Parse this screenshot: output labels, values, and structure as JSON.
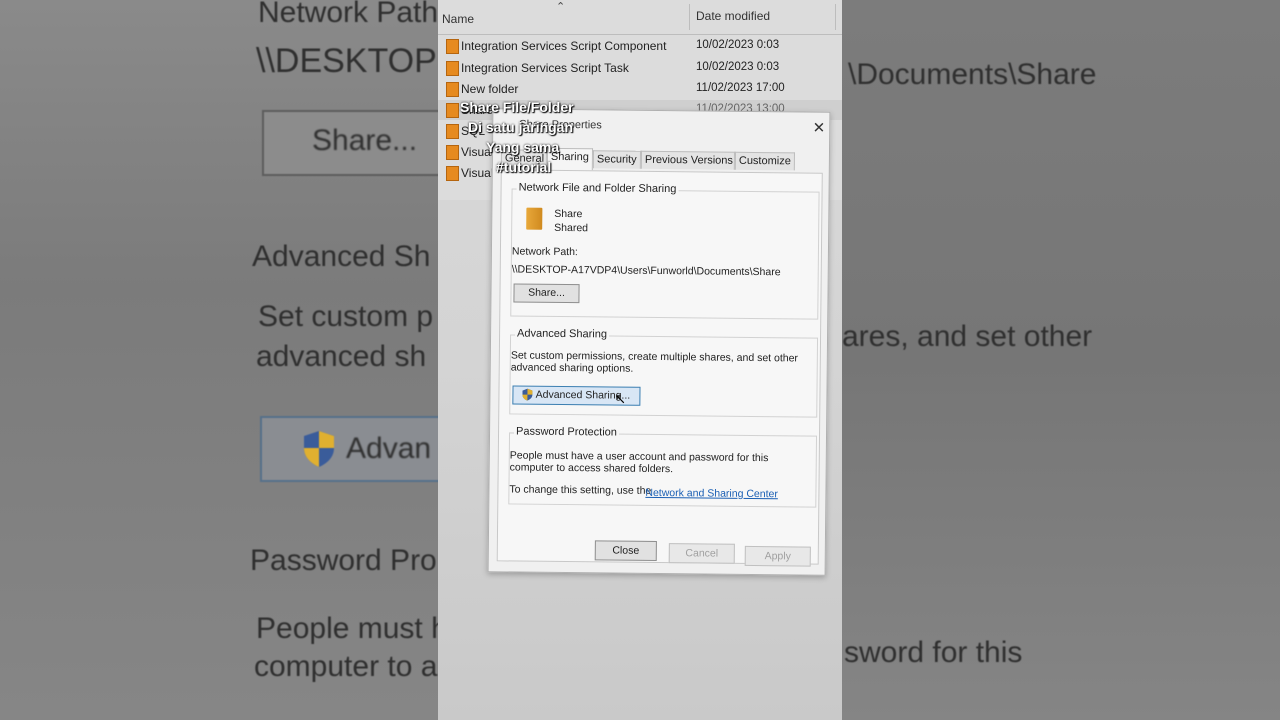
{
  "background_zoom": {
    "left": {
      "network_path_label": "Network Path",
      "network_path_value": "\\\\DESKTOP",
      "share_button": "Share...",
      "advanced_heading": "Advanced Sh",
      "advanced_desc_line1": "Set custom p",
      "advanced_desc_line2": "advanced sh",
      "advanced_button": "Advan",
      "password_heading": "Password Pro",
      "password_desc_line1": "People must h",
      "password_desc_line2": "computer to a"
    },
    "right": {
      "path_fragment": "\\Documents\\Share",
      "advanced_fragment": "ares, and set other",
      "password_fragment": "sword for this"
    }
  },
  "explorer": {
    "columns": {
      "name": "Name",
      "date_modified": "Date modified"
    },
    "rows": [
      {
        "name": "Integration Services Script Component",
        "date": "10/02/2023 0:03"
      },
      {
        "name": "Integration Services Script Task",
        "date": "10/02/2023 0:03"
      },
      {
        "name": "New folder",
        "date": "11/02/2023 17:00"
      },
      {
        "name": "Share",
        "date": "11/02/2023 13:00"
      },
      {
        "name": "SQL",
        "date": ""
      },
      {
        "name": "Visual",
        "date": ""
      },
      {
        "name": "Visual",
        "date": ""
      }
    ]
  },
  "overlay_caption": {
    "line1": "Share File/Folder",
    "line2": "Di satu jaringan",
    "line3": "Yang sama",
    "line4": "#tutorial"
  },
  "dialog": {
    "title": "Share Properties",
    "tabs": [
      "General",
      "Sharing",
      "Security",
      "Previous Versions",
      "Customize"
    ],
    "active_tab": "Sharing",
    "network_sharing": {
      "group_label": "Network File and Folder Sharing",
      "folder_name": "Share",
      "folder_status": "Shared",
      "path_label": "Network Path:",
      "path_value": "\\\\DESKTOP-A17VDP4\\Users\\Funworld\\Documents\\Share",
      "share_button": "Share..."
    },
    "advanced_sharing": {
      "group_label": "Advanced Sharing",
      "desc_line1": "Set custom permissions, create multiple shares, and set other",
      "desc_line2": "advanced sharing options.",
      "button": "Advanced Sharing..."
    },
    "password_protection": {
      "group_label": "Password Protection",
      "desc_line1": "People must have a user account and password for this",
      "desc_line2": "computer to access shared folders.",
      "change_text": "To change this setting, use the",
      "link": "Network and Sharing Center"
    },
    "buttons": {
      "close": "Close",
      "cancel": "Cancel",
      "apply": "Apply"
    }
  },
  "colors": {
    "folder": "#e68a1f",
    "link": "#1a5fb4",
    "hover_button": "#d8e6f5",
    "overlay_text": "#ffffff"
  }
}
